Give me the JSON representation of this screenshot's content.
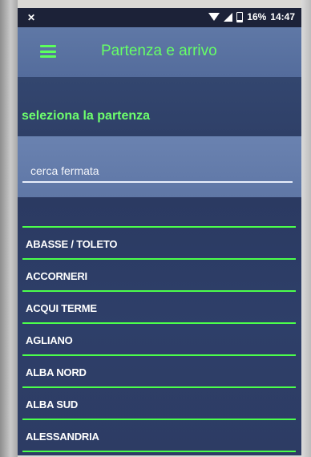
{
  "status_bar": {
    "battery_percent": "16%",
    "time": "14:47",
    "notification_icon": "x-icon",
    "wifi_icon": "wifi-icon",
    "signal_icon": "signal-icon",
    "battery_icon": "battery-icon",
    "battery_level": 0.16
  },
  "app_bar": {
    "title": "Partenza e arrivo",
    "menu_icon": "hamburger-menu-icon"
  },
  "section": {
    "label": "seleziona la partenza"
  },
  "search": {
    "placeholder": "cerca fermata",
    "value": ""
  },
  "stops": [
    {
      "label": "ABASSE / TOLETO"
    },
    {
      "label": "ACCORNERI"
    },
    {
      "label": "ACQUI TERME"
    },
    {
      "label": "AGLIANO"
    },
    {
      "label": "ALBA NORD"
    },
    {
      "label": "ALBA SUD"
    },
    {
      "label": "ALESSANDRIA"
    }
  ],
  "colors": {
    "accent_green": "#5cff5c",
    "app_bar_blue": "#5a72a2",
    "list_background": "#2c3c65"
  }
}
